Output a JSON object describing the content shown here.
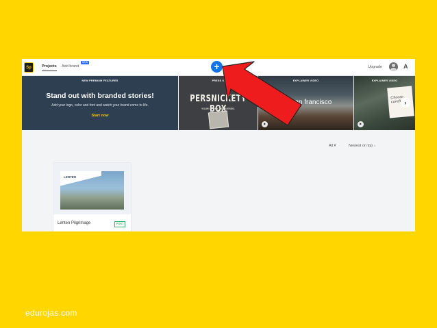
{
  "app": {
    "logo_text": "Sp",
    "tabs": [
      {
        "label": "Projects",
        "active": true
      },
      {
        "label": "Add brand",
        "badge": "NEW"
      }
    ],
    "create_button_symbol": "+",
    "upgrade_label": "Upgrade",
    "avatar_icon": "user-avatar",
    "adobe_icon_symbol": "A"
  },
  "banners": {
    "premium": {
      "label": "NEW PREMIUM FEATURES",
      "headline": "Stand out with branded stories!",
      "subtext": "Add your logo, color and font and watch your brand come to life.",
      "cta": "Start now"
    },
    "press": {
      "label": "PRESS K",
      "brand": "PERSNICKETY BOX",
      "tagline": "YOUR STORY, DELIVERED."
    },
    "video1": {
      "label": "EXPLAINER VIDEO",
      "title": "o san francisco"
    },
    "video2": {
      "label": "EXPLAINER VIDEO",
      "card_text": "Choose carefully"
    },
    "next_symbol": "›"
  },
  "filters": {
    "all": "All ▾",
    "sort": "Newest on top ↓"
  },
  "project": {
    "title": "Lenten Pilgrimage",
    "tag": "POST",
    "thumb_text": "LENTEN"
  },
  "colors": {
    "background": "#FFD600",
    "accent_blue": "#1473E6",
    "arrow_red": "#EE1C1C",
    "banner_navy": "#2E3F52",
    "post_green": "#35B36B"
  },
  "watermark": "edurojas.com"
}
